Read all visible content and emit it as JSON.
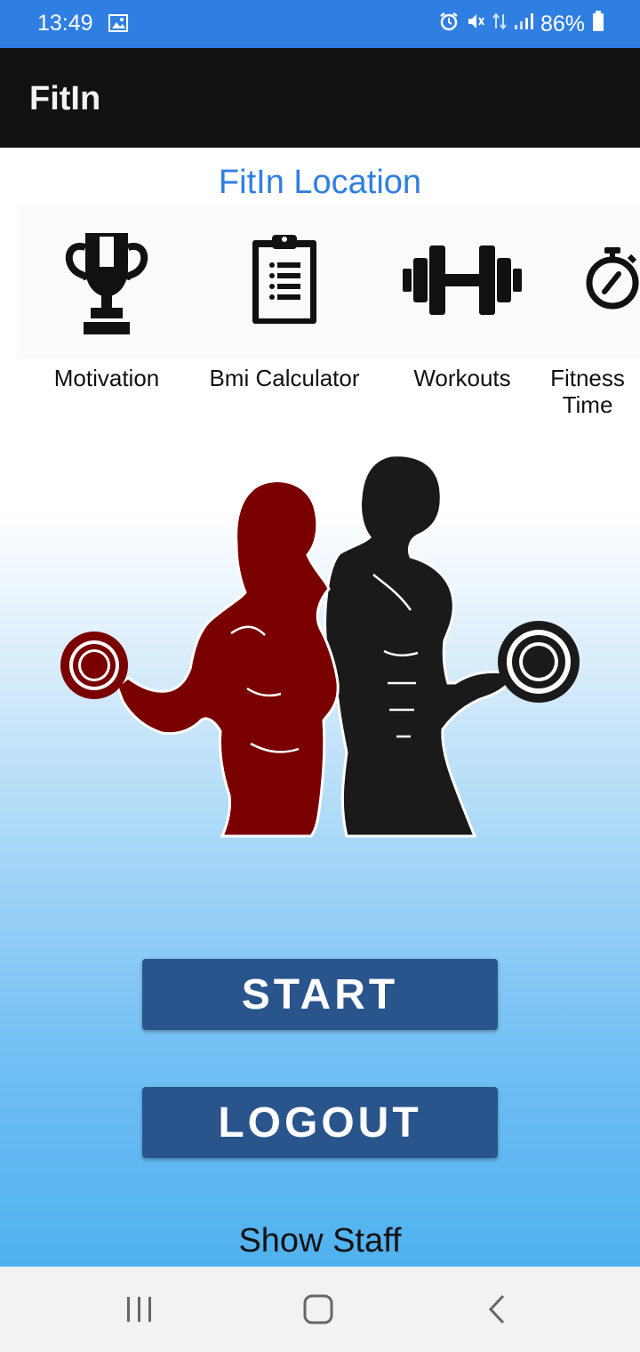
{
  "status_bar": {
    "time": "13:49",
    "battery": "86%"
  },
  "app_bar": {
    "title": "FitIn"
  },
  "location_title": "FitIn Location",
  "categories": [
    {
      "label": "Motivation",
      "icon": "trophy-icon"
    },
    {
      "label": "Bmi Calculator",
      "icon": "clipboard-icon"
    },
    {
      "label": "Workouts",
      "icon": "dumbbell-icon"
    },
    {
      "label": "Fitness Time",
      "icon": "stopwatch-icon"
    }
  ],
  "buttons": {
    "start": "START",
    "logout": "LOGOUT"
  },
  "show_staff": "Show Staff",
  "colors": {
    "status_bar": "#2f7fe3",
    "app_bar": "#121212",
    "accent": "#2f7fe3",
    "button": "#29548c",
    "woman": "#7a0000",
    "man": "#1a1a1a"
  }
}
